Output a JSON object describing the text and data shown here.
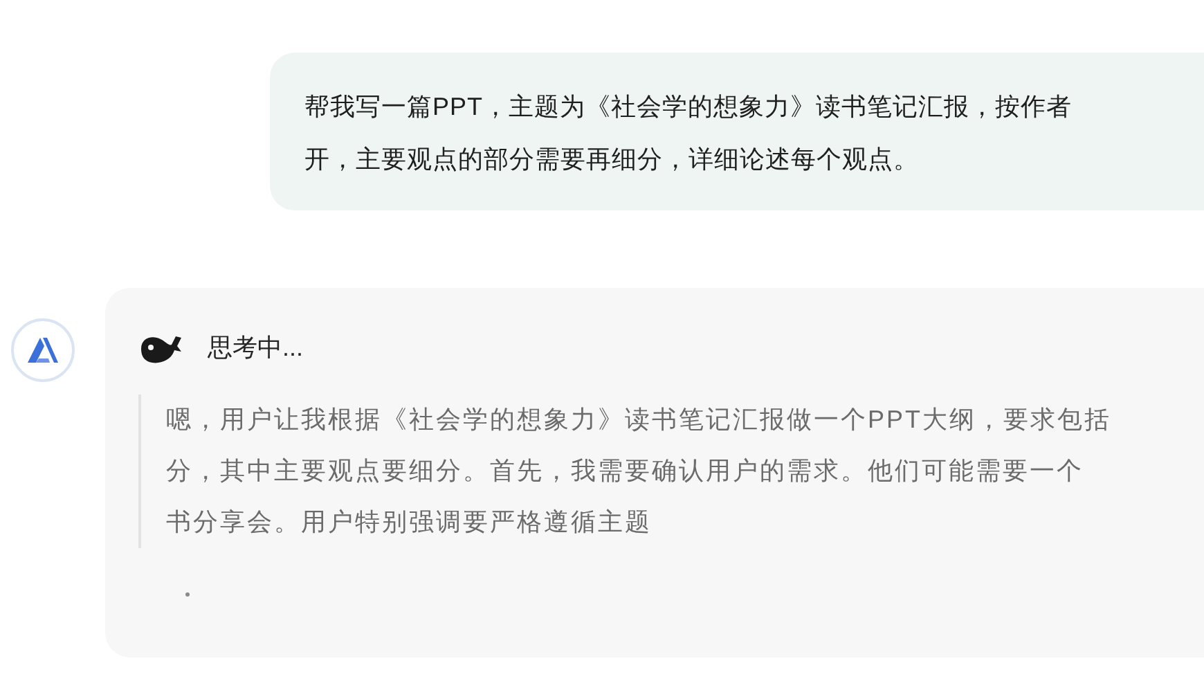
{
  "user_message": {
    "lines": [
      "帮我写一篇PPT，主题为《社会学的想象力》读书笔记汇报，按作者",
      "开，主要观点的部分需要再细分，详细论述每个观点。"
    ]
  },
  "assistant_message": {
    "status": "思考中...",
    "thinking_lines": [
      "嗯，用户让我根据《社会学的想象力》读书笔记汇报做一个PPT大纲，要求包括",
      "分，其中主要观点要细分。首先，我需要确认用户的需求。他们可能需要一个",
      "书分享会。用户特别强调要严格遵循主题"
    ],
    "loading": true
  }
}
